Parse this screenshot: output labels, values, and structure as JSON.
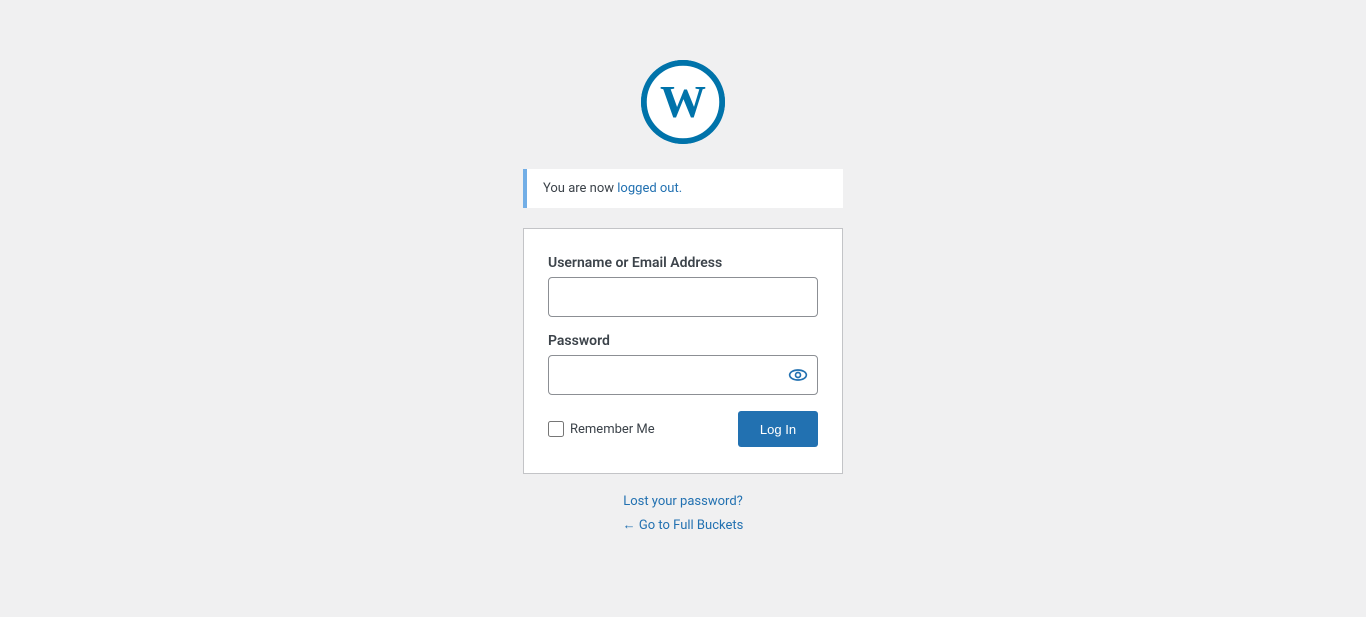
{
  "page": {
    "background_color": "#f0f0f1"
  },
  "logo": {
    "alt": "WordPress"
  },
  "logout_notice": {
    "text_plain": "You are now logged out.",
    "text_highlight": "logged out."
  },
  "form": {
    "username_label": "Username or Email Address",
    "username_placeholder": "",
    "password_label": "Password",
    "password_placeholder": "",
    "remember_label": "Remember Me",
    "submit_label": "Log In"
  },
  "links": {
    "lost_password": "Lost your password?",
    "back_arrow": "←",
    "back_text": "Go to Full Buckets"
  }
}
